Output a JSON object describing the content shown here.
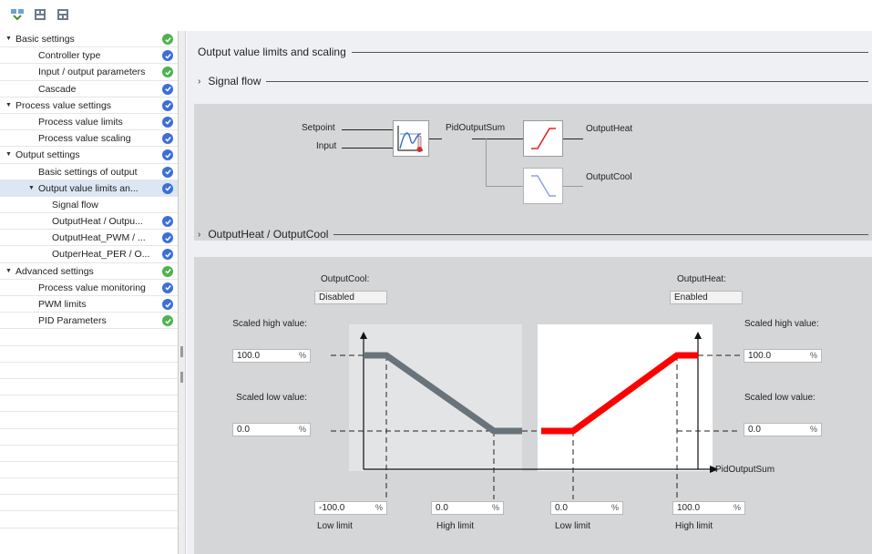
{
  "toolbar": {
    "icons": [
      "functional-view-icon",
      "expand-all-icon",
      "collapse-all-icon"
    ]
  },
  "nav": {
    "items": [
      {
        "label": "Basic settings",
        "level": 0,
        "expanded": true,
        "status": "green"
      },
      {
        "label": "Controller type",
        "level": 1,
        "status": "blue"
      },
      {
        "label": "Input / output parameters",
        "level": 1,
        "status": "green"
      },
      {
        "label": "Cascade",
        "level": 1,
        "status": "blue"
      },
      {
        "label": "Process value settings",
        "level": 0,
        "expanded": true,
        "status": "blue"
      },
      {
        "label": "Process value limits",
        "level": 1,
        "status": "blue"
      },
      {
        "label": "Process value scaling",
        "level": 1,
        "status": "blue"
      },
      {
        "label": "Output settings",
        "level": 0,
        "expanded": true,
        "status": "blue"
      },
      {
        "label": "Basic settings of output",
        "level": 1,
        "status": "blue"
      },
      {
        "label": "Output value limits an...",
        "level": 1,
        "expanded": true,
        "status": "blue",
        "selected": true
      },
      {
        "label": "Signal flow",
        "level": 2,
        "status": ""
      },
      {
        "label": "OutputHeat / Outpu...",
        "level": 2,
        "status": "blue"
      },
      {
        "label": "OutputHeat_PWM / ...",
        "level": 2,
        "status": "blue"
      },
      {
        "label": "OutperHeat_PER / O...",
        "level": 2,
        "status": "blue"
      },
      {
        "label": "Advanced settings",
        "level": 0,
        "expanded": true,
        "status": "green"
      },
      {
        "label": "Process value monitoring",
        "level": 1,
        "status": "blue"
      },
      {
        "label": "PWM limits",
        "level": 1,
        "status": "blue"
      },
      {
        "label": "PID Parameters",
        "level": 1,
        "status": "green"
      }
    ]
  },
  "main": {
    "title": "Output value limits and scaling",
    "signal_flow": {
      "heading": "Signal flow",
      "setpoint": "Setpoint",
      "input": "Input",
      "pid_output_sum": "PidOutputSum",
      "output_heat": "OutputHeat",
      "output_cool": "OutputCool"
    },
    "heat_cool": {
      "heading": "OutputHeat / OutputCool",
      "cool_label": "OutputCool:",
      "cool_state": "Disabled",
      "heat_label": "OutputHeat:",
      "heat_state": "Enabled",
      "left_scaled_high_label": "Scaled high value:",
      "left_scaled_high_value": "100.0",
      "left_scaled_low_label": "Scaled low value:",
      "left_scaled_low_value": "0.0",
      "right_scaled_high_label": "Scaled high value:",
      "right_scaled_high_value": "100.0",
      "right_scaled_low_label": "Scaled low value:",
      "right_scaled_low_value": "0.0",
      "percent": "%",
      "axis_label": "PidOutputSum",
      "cool_low_limit_value": "-100.0",
      "cool_high_limit_value": "0.0",
      "heat_low_limit_value": "0.0",
      "heat_high_limit_value": "100.0",
      "low_limit_label": "Low limit",
      "high_limit_label": "High limit"
    },
    "colors": {
      "heat_curve": "#ff0000",
      "cool_curve": "#68737a",
      "status_green": "#4db34d",
      "status_blue": "#3c6fd8"
    }
  }
}
